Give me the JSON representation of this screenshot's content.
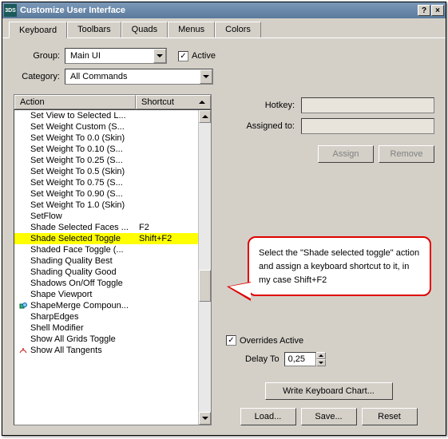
{
  "window": {
    "title": "Customize User Interface",
    "help_btn": "?",
    "close_btn": "×"
  },
  "tabs": [
    {
      "label": "Keyboard",
      "active": true
    },
    {
      "label": "Toolbars",
      "active": false
    },
    {
      "label": "Quads",
      "active": false
    },
    {
      "label": "Menus",
      "active": false
    },
    {
      "label": "Colors",
      "active": false
    }
  ],
  "group": {
    "label": "Group:",
    "value": "Main UI"
  },
  "active_chk": {
    "label": "Active",
    "checked": true
  },
  "category": {
    "label": "Category:",
    "value": "All Commands"
  },
  "columns": {
    "action": "Action",
    "shortcut": "Shortcut"
  },
  "items": [
    {
      "action": "Set View to Selected L...",
      "shortcut": ""
    },
    {
      "action": "Set Weight Custom (S...",
      "shortcut": ""
    },
    {
      "action": "Set Weight To 0.0 (Skin)",
      "shortcut": ""
    },
    {
      "action": "Set Weight To 0.10 (S...",
      "shortcut": ""
    },
    {
      "action": "Set Weight To 0.25 (S...",
      "shortcut": ""
    },
    {
      "action": "Set Weight To 0.5 (Skin)",
      "shortcut": ""
    },
    {
      "action": "Set Weight To 0.75 (S...",
      "shortcut": ""
    },
    {
      "action": "Set Weight To 0.90 (S...",
      "shortcut": ""
    },
    {
      "action": "Set Weight To 1.0 (Skin)",
      "shortcut": ""
    },
    {
      "action": "SetFlow",
      "shortcut": ""
    },
    {
      "action": "Shade Selected Faces ...",
      "shortcut": "F2"
    },
    {
      "action": "Shade Selected Toggle",
      "shortcut": "Shift+F2",
      "highlighted": true
    },
    {
      "action": "Shaded Face Toggle (...",
      "shortcut": ""
    },
    {
      "action": "Shading Quality Best",
      "shortcut": ""
    },
    {
      "action": "Shading Quality Good",
      "shortcut": ""
    },
    {
      "action": "Shadows On/Off Toggle",
      "shortcut": ""
    },
    {
      "action": "Shape Viewport",
      "shortcut": ""
    },
    {
      "action": "ShapeMerge Compoun...",
      "shortcut": "",
      "icon": "shapemerge"
    },
    {
      "action": "SharpEdges",
      "shortcut": ""
    },
    {
      "action": "Shell Modifier",
      "shortcut": ""
    },
    {
      "action": "Show All Grids Toggle",
      "shortcut": ""
    },
    {
      "action": "Show All Tangents",
      "shortcut": "",
      "icon": "tangent"
    }
  ],
  "hotkey": {
    "label": "Hotkey:",
    "value": ""
  },
  "assigned": {
    "label": "Assigned to:",
    "value": ""
  },
  "buttons": {
    "assign": "Assign",
    "remove": "Remove",
    "write_chart": "Write Keyboard Chart...",
    "load": "Load...",
    "save": "Save...",
    "reset": "Reset"
  },
  "overrides": {
    "label": "Overrides Active",
    "checked": true
  },
  "delay": {
    "label": "Delay To",
    "value": "0,25"
  },
  "callout": "Select the \"Shade selected toggle\" action and assign a keyboard shortcut to it, in my case Shift+F2"
}
